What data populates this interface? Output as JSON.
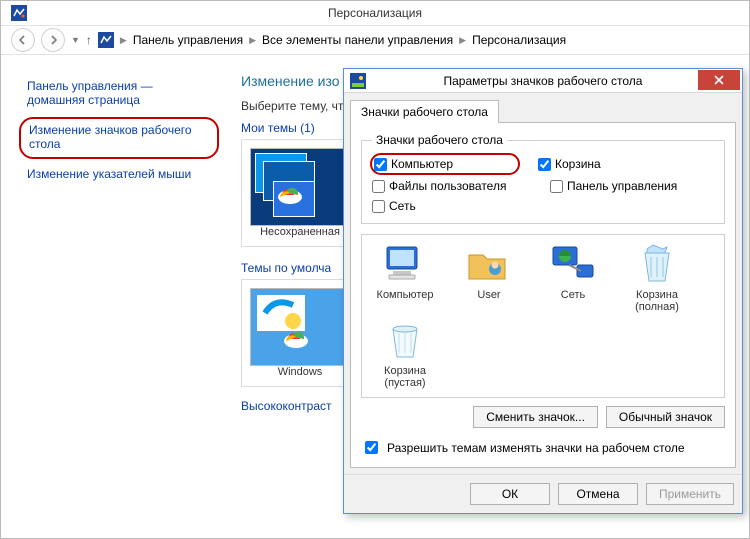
{
  "parent": {
    "title": "Персонализация",
    "breadcrumbs": [
      "Панель управления",
      "Все элементы панели управления",
      "Персонализация"
    ]
  },
  "sidebar": {
    "items": [
      {
        "label": "Панель управления — домашняя страница",
        "selected": false
      },
      {
        "label": "Изменение значков рабочего стола",
        "selected": true
      },
      {
        "label": "Изменение указателей мыши",
        "selected": false
      }
    ]
  },
  "main": {
    "heading": "Изменение изо",
    "subheading": "Выберите тему, что",
    "my_themes_label": "Мои темы (1)",
    "theme_unsaved_label": "Несохраненная",
    "default_themes_label": "Темы по умолча",
    "theme_win_label": "Windows",
    "high_contrast_label": "Высококонтраст"
  },
  "dialog": {
    "title": "Параметры значков рабочего стола",
    "tab_label": "Значки рабочего стола",
    "group_legend": "Значки рабочего стола",
    "checkboxes": {
      "computer": {
        "label": "Компьютер",
        "checked": true
      },
      "recyclebin": {
        "label": "Корзина",
        "checked": true
      },
      "userfiles": {
        "label": "Файлы пользователя",
        "checked": false
      },
      "cpl": {
        "label": "Панель управления",
        "checked": false
      },
      "network": {
        "label": "Сеть",
        "checked": false
      }
    },
    "icons": [
      {
        "name": "computer-icon",
        "label": "Компьютер"
      },
      {
        "name": "user-icon",
        "label": "User"
      },
      {
        "name": "network-icon",
        "label": "Сеть"
      },
      {
        "name": "bin-full-icon",
        "label": "Корзина (полная)"
      },
      {
        "name": "bin-empty-icon",
        "label": "Корзина (пустая)"
      }
    ],
    "change_icon_btn": "Сменить значок...",
    "default_icon_btn": "Обычный значок",
    "allow_themes_label": "Разрешить темам изменять значки на рабочем столе",
    "allow_themes_checked": true,
    "ok": "ОК",
    "cancel": "Отмена",
    "apply": "Применить"
  }
}
